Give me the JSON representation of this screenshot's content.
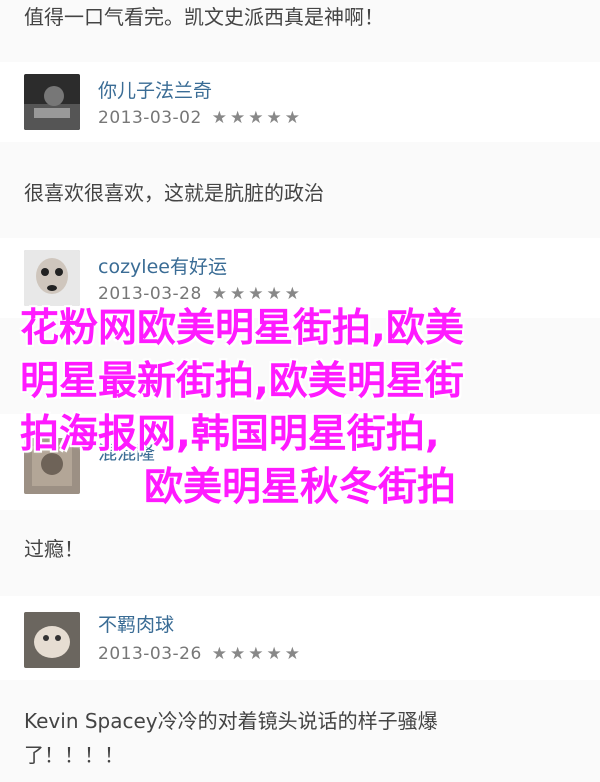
{
  "comments": [
    {
      "text": "值得一口气看完。凯文史派西真是神啊！"
    },
    {
      "text": "很喜欢很喜欢，这就是肮脏的政治"
    },
    {
      "text": "过瘾！"
    },
    {
      "text_line1": "Kevin Spacey冷冷的对着镜头说话的样子骚爆",
      "text_line2": "了！！！！"
    }
  ],
  "users": [
    {
      "name": "你儿子法兰奇",
      "date": "2013-03-02",
      "stars": "★★★★★"
    },
    {
      "name": "cozylee有好运",
      "date": "2013-03-28",
      "stars": "★★★★★"
    },
    {
      "name": "混混隆",
      "date": "",
      "stars": ""
    },
    {
      "name": "不羁肉球",
      "date": "2013-03-26",
      "stars": "★★★★★"
    }
  ],
  "overlay": {
    "line1": "花粉网欧美明星街拍,欧美",
    "line2": "明星最新街拍,欧美明星街",
    "line3": "拍海报网,韩国明星街拍,",
    "line4": "欧美明星秋冬街拍",
    "color": "#ff1aff"
  }
}
